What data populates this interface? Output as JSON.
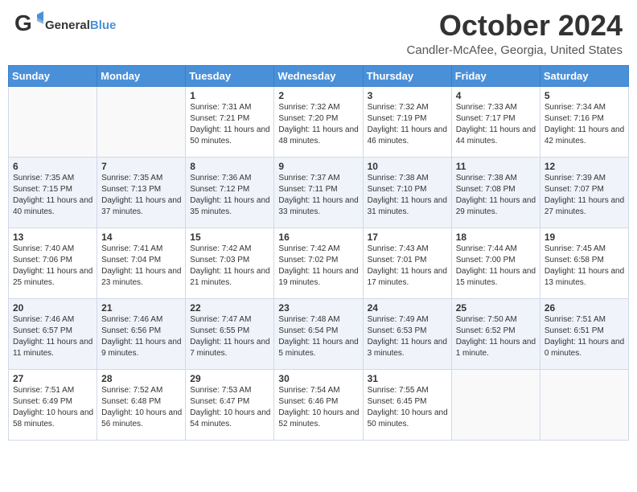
{
  "header": {
    "logo_general": "General",
    "logo_blue": "Blue",
    "month_title": "October 2024",
    "location": "Candler-McAfee, Georgia, United States"
  },
  "days_of_week": [
    "Sunday",
    "Monday",
    "Tuesday",
    "Wednesday",
    "Thursday",
    "Friday",
    "Saturday"
  ],
  "weeks": [
    [
      {
        "day": "",
        "sunrise": "",
        "sunset": "",
        "daylight": ""
      },
      {
        "day": "",
        "sunrise": "",
        "sunset": "",
        "daylight": ""
      },
      {
        "day": "1",
        "sunrise": "Sunrise: 7:31 AM",
        "sunset": "Sunset: 7:21 PM",
        "daylight": "Daylight: 11 hours and 50 minutes."
      },
      {
        "day": "2",
        "sunrise": "Sunrise: 7:32 AM",
        "sunset": "Sunset: 7:20 PM",
        "daylight": "Daylight: 11 hours and 48 minutes."
      },
      {
        "day": "3",
        "sunrise": "Sunrise: 7:32 AM",
        "sunset": "Sunset: 7:19 PM",
        "daylight": "Daylight: 11 hours and 46 minutes."
      },
      {
        "day": "4",
        "sunrise": "Sunrise: 7:33 AM",
        "sunset": "Sunset: 7:17 PM",
        "daylight": "Daylight: 11 hours and 44 minutes."
      },
      {
        "day": "5",
        "sunrise": "Sunrise: 7:34 AM",
        "sunset": "Sunset: 7:16 PM",
        "daylight": "Daylight: 11 hours and 42 minutes."
      }
    ],
    [
      {
        "day": "6",
        "sunrise": "Sunrise: 7:35 AM",
        "sunset": "Sunset: 7:15 PM",
        "daylight": "Daylight: 11 hours and 40 minutes."
      },
      {
        "day": "7",
        "sunrise": "Sunrise: 7:35 AM",
        "sunset": "Sunset: 7:13 PM",
        "daylight": "Daylight: 11 hours and 37 minutes."
      },
      {
        "day": "8",
        "sunrise": "Sunrise: 7:36 AM",
        "sunset": "Sunset: 7:12 PM",
        "daylight": "Daylight: 11 hours and 35 minutes."
      },
      {
        "day": "9",
        "sunrise": "Sunrise: 7:37 AM",
        "sunset": "Sunset: 7:11 PM",
        "daylight": "Daylight: 11 hours and 33 minutes."
      },
      {
        "day": "10",
        "sunrise": "Sunrise: 7:38 AM",
        "sunset": "Sunset: 7:10 PM",
        "daylight": "Daylight: 11 hours and 31 minutes."
      },
      {
        "day": "11",
        "sunrise": "Sunrise: 7:38 AM",
        "sunset": "Sunset: 7:08 PM",
        "daylight": "Daylight: 11 hours and 29 minutes."
      },
      {
        "day": "12",
        "sunrise": "Sunrise: 7:39 AM",
        "sunset": "Sunset: 7:07 PM",
        "daylight": "Daylight: 11 hours and 27 minutes."
      }
    ],
    [
      {
        "day": "13",
        "sunrise": "Sunrise: 7:40 AM",
        "sunset": "Sunset: 7:06 PM",
        "daylight": "Daylight: 11 hours and 25 minutes."
      },
      {
        "day": "14",
        "sunrise": "Sunrise: 7:41 AM",
        "sunset": "Sunset: 7:04 PM",
        "daylight": "Daylight: 11 hours and 23 minutes."
      },
      {
        "day": "15",
        "sunrise": "Sunrise: 7:42 AM",
        "sunset": "Sunset: 7:03 PM",
        "daylight": "Daylight: 11 hours and 21 minutes."
      },
      {
        "day": "16",
        "sunrise": "Sunrise: 7:42 AM",
        "sunset": "Sunset: 7:02 PM",
        "daylight": "Daylight: 11 hours and 19 minutes."
      },
      {
        "day": "17",
        "sunrise": "Sunrise: 7:43 AM",
        "sunset": "Sunset: 7:01 PM",
        "daylight": "Daylight: 11 hours and 17 minutes."
      },
      {
        "day": "18",
        "sunrise": "Sunrise: 7:44 AM",
        "sunset": "Sunset: 7:00 PM",
        "daylight": "Daylight: 11 hours and 15 minutes."
      },
      {
        "day": "19",
        "sunrise": "Sunrise: 7:45 AM",
        "sunset": "Sunset: 6:58 PM",
        "daylight": "Daylight: 11 hours and 13 minutes."
      }
    ],
    [
      {
        "day": "20",
        "sunrise": "Sunrise: 7:46 AM",
        "sunset": "Sunset: 6:57 PM",
        "daylight": "Daylight: 11 hours and 11 minutes."
      },
      {
        "day": "21",
        "sunrise": "Sunrise: 7:46 AM",
        "sunset": "Sunset: 6:56 PM",
        "daylight": "Daylight: 11 hours and 9 minutes."
      },
      {
        "day": "22",
        "sunrise": "Sunrise: 7:47 AM",
        "sunset": "Sunset: 6:55 PM",
        "daylight": "Daylight: 11 hours and 7 minutes."
      },
      {
        "day": "23",
        "sunrise": "Sunrise: 7:48 AM",
        "sunset": "Sunset: 6:54 PM",
        "daylight": "Daylight: 11 hours and 5 minutes."
      },
      {
        "day": "24",
        "sunrise": "Sunrise: 7:49 AM",
        "sunset": "Sunset: 6:53 PM",
        "daylight": "Daylight: 11 hours and 3 minutes."
      },
      {
        "day": "25",
        "sunrise": "Sunrise: 7:50 AM",
        "sunset": "Sunset: 6:52 PM",
        "daylight": "Daylight: 11 hours and 1 minute."
      },
      {
        "day": "26",
        "sunrise": "Sunrise: 7:51 AM",
        "sunset": "Sunset: 6:51 PM",
        "daylight": "Daylight: 11 hours and 0 minutes."
      }
    ],
    [
      {
        "day": "27",
        "sunrise": "Sunrise: 7:51 AM",
        "sunset": "Sunset: 6:49 PM",
        "daylight": "Daylight: 10 hours and 58 minutes."
      },
      {
        "day": "28",
        "sunrise": "Sunrise: 7:52 AM",
        "sunset": "Sunset: 6:48 PM",
        "daylight": "Daylight: 10 hours and 56 minutes."
      },
      {
        "day": "29",
        "sunrise": "Sunrise: 7:53 AM",
        "sunset": "Sunset: 6:47 PM",
        "daylight": "Daylight: 10 hours and 54 minutes."
      },
      {
        "day": "30",
        "sunrise": "Sunrise: 7:54 AM",
        "sunset": "Sunset: 6:46 PM",
        "daylight": "Daylight: 10 hours and 52 minutes."
      },
      {
        "day": "31",
        "sunrise": "Sunrise: 7:55 AM",
        "sunset": "Sunset: 6:45 PM",
        "daylight": "Daylight: 10 hours and 50 minutes."
      },
      {
        "day": "",
        "sunrise": "",
        "sunset": "",
        "daylight": ""
      },
      {
        "day": "",
        "sunrise": "",
        "sunset": "",
        "daylight": ""
      }
    ]
  ]
}
